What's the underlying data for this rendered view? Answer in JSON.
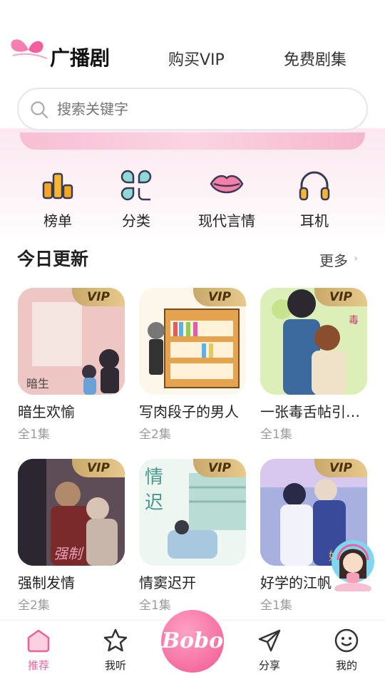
{
  "header": {
    "title": "广播剧",
    "nav": {
      "vip": "购买VIP",
      "free": "免费剧集"
    }
  },
  "search": {
    "placeholder": "搜索关键字"
  },
  "categories": [
    {
      "label": "榜单",
      "icon": "ranking-icon"
    },
    {
      "label": "分类",
      "icon": "category-icon"
    },
    {
      "label": "现代言情",
      "icon": "lips-icon"
    },
    {
      "label": "耳机",
      "icon": "headphones-icon"
    }
  ],
  "section": {
    "title": "今日更新",
    "more": "更多",
    "more_icon": "›"
  },
  "vip_badge": "VIP",
  "dramas": [
    {
      "title": "暗生欢愉",
      "episodes": "全1集",
      "cover_color": "#e9b9b6"
    },
    {
      "title": "写肉段子的男人",
      "episodes": "全2集",
      "cover_color": "#fdf6e8"
    },
    {
      "title": "一张毒舌帖引起的悲剧",
      "episodes": "全1集",
      "cover_color": "#d6ecb0"
    },
    {
      "title": "强制发情",
      "episodes": "全2集",
      "cover_color": "#6a5660"
    },
    {
      "title": "情窦迟开",
      "episodes": "全1集",
      "cover_color": "#d9ede8"
    },
    {
      "title": "好学的江帆",
      "episodes": "全1集",
      "cover_color": "#9aa4d8"
    }
  ],
  "tabbar": {
    "items": [
      {
        "label": "推荐",
        "icon": "home-icon",
        "active": true
      },
      {
        "label": "我听",
        "icon": "star-icon",
        "active": false
      },
      {
        "label": "分享",
        "icon": "send-icon",
        "active": false
      },
      {
        "label": "我的",
        "icon": "smile-icon",
        "active": false
      }
    ],
    "center_logo": "Bobo"
  },
  "colors": {
    "accent": "#f2609a",
    "vip_gold": "#d7b777"
  }
}
